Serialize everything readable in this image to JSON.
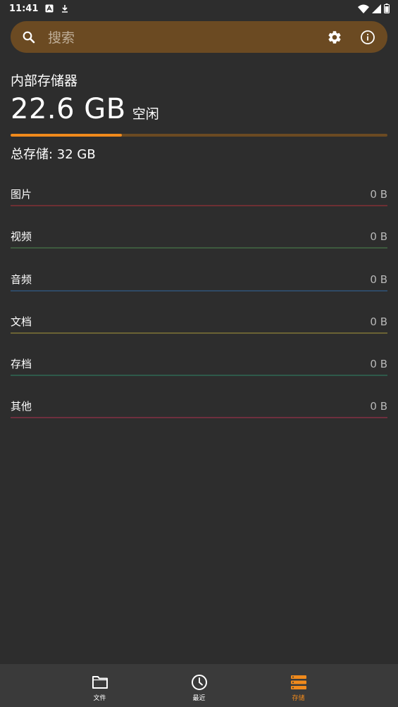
{
  "status_bar": {
    "time": "11:41",
    "icons_left": [
      "a-box-icon",
      "download-icon"
    ],
    "icons_right": [
      "wifi-icon",
      "cellular-signal-icon",
      "battery-icon"
    ]
  },
  "search": {
    "placeholder": "搜索",
    "icons": [
      "search-icon",
      "settings-icon",
      "info-icon"
    ]
  },
  "storage": {
    "title": "内部存储器",
    "free_value": "22.6 GB",
    "free_label": "空闲",
    "used_fraction": 0.295,
    "total_label": "总存储: 32 GB"
  },
  "categories": [
    {
      "name": "图片",
      "size": "0 B",
      "color": "#6e2f33"
    },
    {
      "name": "视频",
      "size": "0 B",
      "color": "#3d5a3e"
    },
    {
      "name": "音频",
      "size": "0 B",
      "color": "#2f4a66"
    },
    {
      "name": "文档",
      "size": "0 B",
      "color": "#6b6334"
    },
    {
      "name": "存档",
      "size": "0 B",
      "color": "#2e5a4a"
    },
    {
      "name": "其他",
      "size": "0 B",
      "color": "#6e2f3e"
    }
  ],
  "bottom_nav": {
    "items": [
      {
        "label": "文件",
        "icon": "folder-icon"
      },
      {
        "label": "最近",
        "icon": "clock-icon"
      },
      {
        "label": "存储",
        "icon": "storage-icon"
      }
    ],
    "active_index": 2
  },
  "colors": {
    "background": "#2d2d2d",
    "accent": "#f08a1c",
    "search_bg": "#6b4a22",
    "nav_bg": "#3a3a3a"
  }
}
